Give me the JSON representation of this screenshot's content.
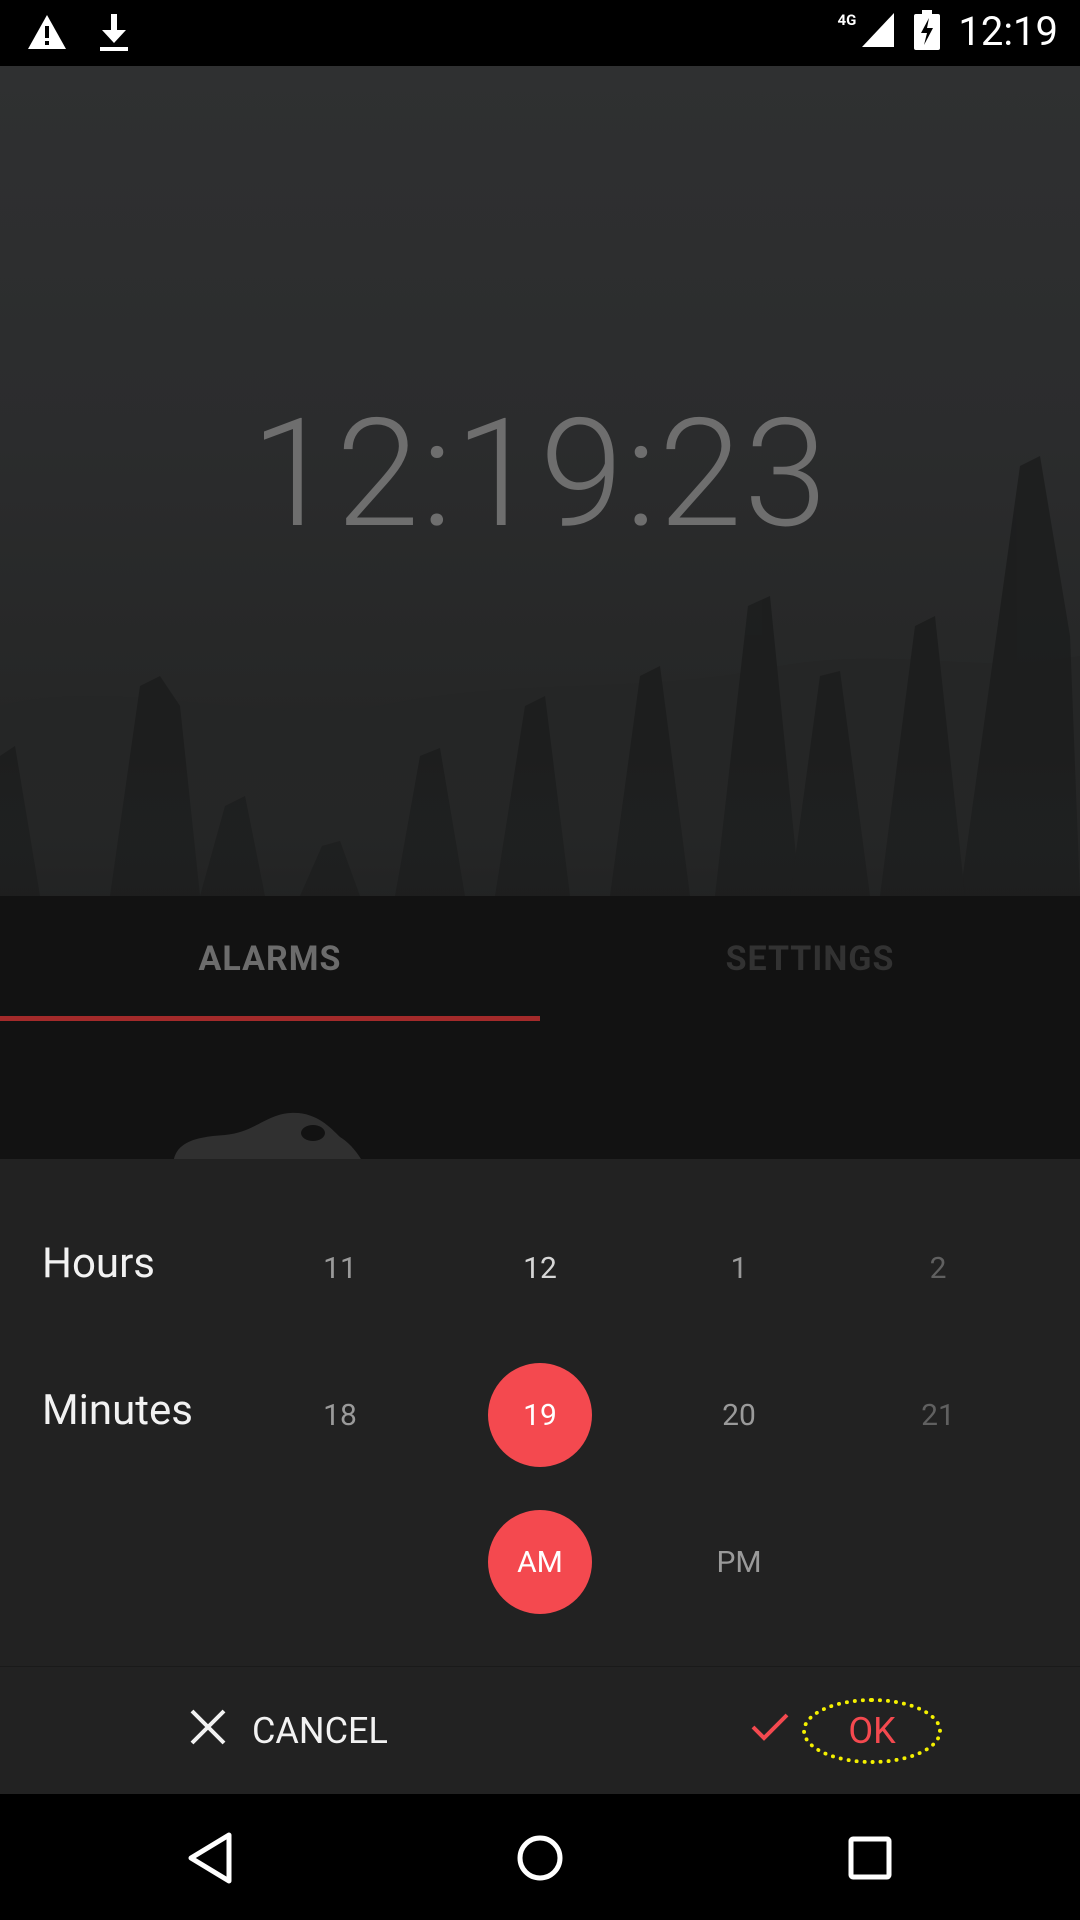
{
  "status_bar": {
    "time": "12:19",
    "network": "4G",
    "icons": [
      "warning-icon",
      "download-icon",
      "signal-icon",
      "battery-charging-icon"
    ]
  },
  "clock": {
    "display": "12:19:23"
  },
  "tabs": [
    {
      "label": "ALARMS",
      "selected": true
    },
    {
      "label": "SETTINGS",
      "selected": false
    }
  ],
  "time_picker": {
    "hours_label": "Hours",
    "minutes_label": "Minutes",
    "hours": [
      "11",
      "12",
      "1",
      "2"
    ],
    "selected_hour": "12",
    "minutes": [
      "18",
      "19",
      "20",
      "21"
    ],
    "selected_minute": "19",
    "meridiem": [
      "AM",
      "PM"
    ],
    "selected_meridiem": "AM"
  },
  "actions": {
    "cancel_label": "CANCEL",
    "ok_label": "OK"
  },
  "colors": {
    "accent": "#f4494f",
    "tab_indicator": "#a32a2a",
    "sheet_bg": "#222222",
    "highlight_ring": "#f4f000"
  },
  "nav_icons": [
    "back-icon",
    "home-icon",
    "recents-icon"
  ]
}
